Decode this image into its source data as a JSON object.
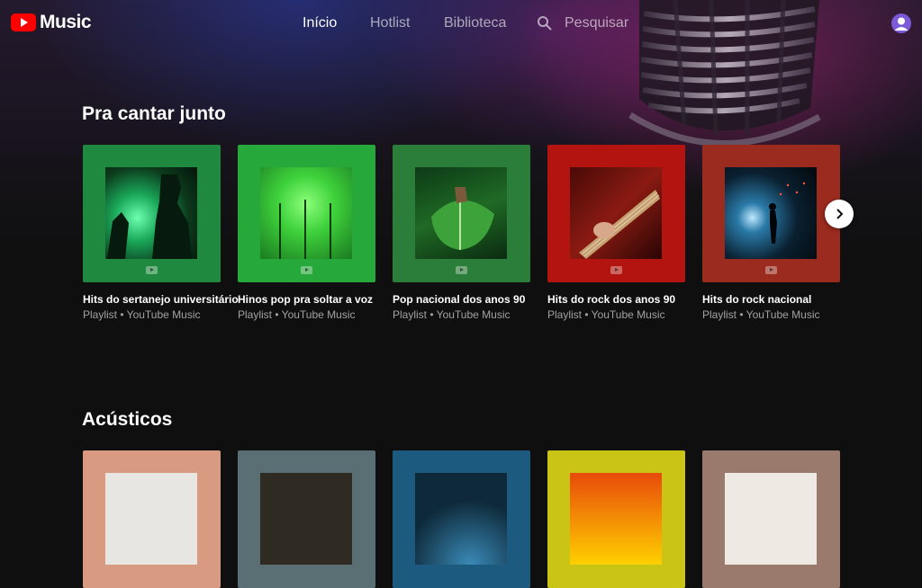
{
  "app": {
    "logo_text": "Music"
  },
  "nav": {
    "items": [
      {
        "label": "Início",
        "active": true
      },
      {
        "label": "Hotlist",
        "active": false
      },
      {
        "label": "Biblioteca",
        "active": false
      }
    ],
    "search_label": "Pesquisar"
  },
  "sections": [
    {
      "title": "Pra cantar junto",
      "cards": [
        {
          "title": "Hits do sertanejo universitário",
          "subtitle": "Playlist • YouTube Music",
          "frame_color": "#1f8a3f"
        },
        {
          "title": "Hinos pop pra soltar a voz",
          "subtitle": "Playlist • YouTube Music",
          "frame_color": "#27a83a"
        },
        {
          "title": "Pop nacional dos anos 90",
          "subtitle": "Playlist • YouTube Music",
          "frame_color": "#2b7d3a"
        },
        {
          "title": "Hits do rock dos anos 90",
          "subtitle": "Playlist • YouTube Music",
          "frame_color": "#b3140f"
        },
        {
          "title": "Hits do rock nacional",
          "subtitle": "Playlist • YouTube Music",
          "frame_color": "#9a2b1e"
        }
      ]
    },
    {
      "title": "Acústicos",
      "cards": [
        {
          "frame_color": "#d99a82"
        },
        {
          "frame_color": "#5a6f73"
        },
        {
          "frame_color": "#1c5a80"
        },
        {
          "frame_color": "#c9c416"
        },
        {
          "frame_color": "#9a7a6c"
        }
      ]
    }
  ],
  "icons": [
    "youtube-music-logo-icon",
    "search-icon",
    "avatar-icon",
    "chevron-right-icon",
    "youtube-mark-icon"
  ],
  "colors": {
    "accent": "#ff0000",
    "background": "#0f0f10"
  }
}
